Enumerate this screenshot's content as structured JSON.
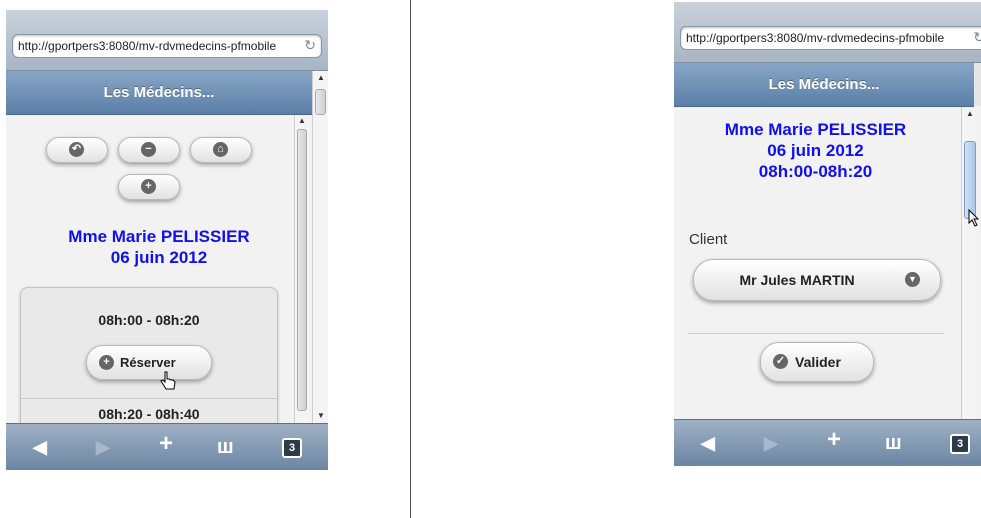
{
  "browser": {
    "url": "http://gportpers3:8080/mv-rdvmedecins-pfmobile",
    "reload_icon": "reload-icon"
  },
  "header": {
    "title": "Les Médecins..."
  },
  "toolbar": {
    "icons": [
      "back-arrow-icon",
      "minus-icon",
      "home-icon",
      "plus-icon"
    ]
  },
  "appointment_left": {
    "doctor": "Mme Marie PELISSIER",
    "date": "06 juin 2012",
    "slot": "08h:00 - 08h:20",
    "reserve_label": "Réserver",
    "next_slot_partial": "08h:20 - 08h:40"
  },
  "appointment_right": {
    "doctor": "Mme Marie PELISSIER",
    "date": "06 juin 2012",
    "time": "08h:00-08h:20",
    "client_label": "Client",
    "client_value": "Mr Jules MARTIN",
    "validate_label": "Valider"
  },
  "tabbar": {
    "icons": [
      "back-icon",
      "forward-icon",
      "add-bookmark-icon",
      "bookmarks-book-icon",
      "tabs-icon"
    ],
    "tabs_count": "3"
  }
}
